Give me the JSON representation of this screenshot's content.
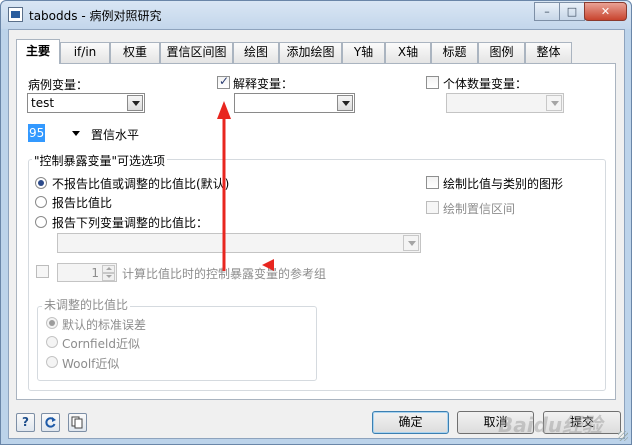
{
  "window": {
    "title": "tabodds - 病例对照研究",
    "min_label": "–",
    "max_label": "□",
    "close_label": "✕"
  },
  "tabs": [
    {
      "label": "主要"
    },
    {
      "label": "if/in"
    },
    {
      "label": "权重"
    },
    {
      "label": "置信区间图"
    },
    {
      "label": "绘图"
    },
    {
      "label": "添加绘图"
    },
    {
      "label": "Y轴"
    },
    {
      "label": "X轴"
    },
    {
      "label": "标题"
    },
    {
      "label": "图例"
    },
    {
      "label": "整体"
    }
  ],
  "main": {
    "case_var_label": "病例变量：",
    "case_var_value": "test",
    "explanatory_label": "解释变量：",
    "explanatory_checked": true,
    "explanatory_value": "",
    "count_var_label": "个体数量变量：",
    "count_var_value": "",
    "level_value": "95",
    "level_label": "置信水平",
    "exposure_group_title": "\"控制暴露变量\"可选选项",
    "radio_options": [
      {
        "label": "不报告比值或调整的比值比(默认)",
        "selected": true
      },
      {
        "label": "报告比值比",
        "selected": false
      },
      {
        "label": "报告下列变量调整的比值比：",
        "selected": false
      }
    ],
    "adjust_var_value": "",
    "graph_option_label": "绘制比值与类别的图形",
    "ci_option_label": "绘制置信区间",
    "base_value": "1",
    "base_label": "计算比值比时的控制暴露变量的参考组",
    "unadjusted_title": "未调整的比值比",
    "unadjusted_options": [
      {
        "label": "默认的标准误差",
        "selected": true
      },
      {
        "label": "Cornfield近似",
        "selected": false
      },
      {
        "label": "Woolf近似",
        "selected": false
      }
    ]
  },
  "footer": {
    "help_icon_label": "?",
    "ok_label": "确定",
    "cancel_label": "取消",
    "submit_label": "提交"
  },
  "annotation_color": "#e8261f",
  "watermark_text": "Baidu经验"
}
